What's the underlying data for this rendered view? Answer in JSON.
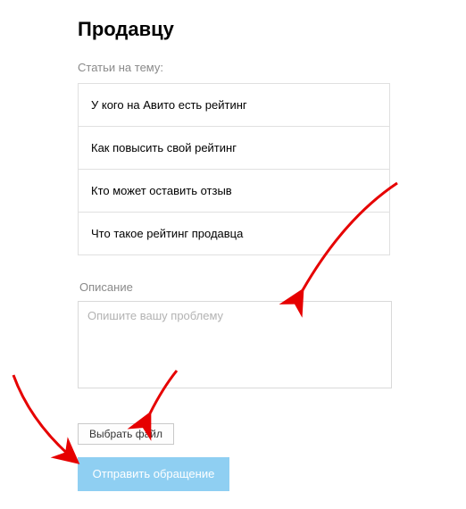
{
  "title": "Продавцу",
  "articles_label": "Статьи на тему:",
  "articles": [
    {
      "label": "У кого на Авито есть рейтинг"
    },
    {
      "label": "Как повысить свой рейтинг"
    },
    {
      "label": "Кто может оставить отзыв"
    },
    {
      "label": "Что такое рейтинг продавца"
    }
  ],
  "description_label": "Описание",
  "description_placeholder": "Опишите вашу проблему",
  "file_button_label": "Выбрать файл",
  "submit_button_label": "Отправить обращение"
}
